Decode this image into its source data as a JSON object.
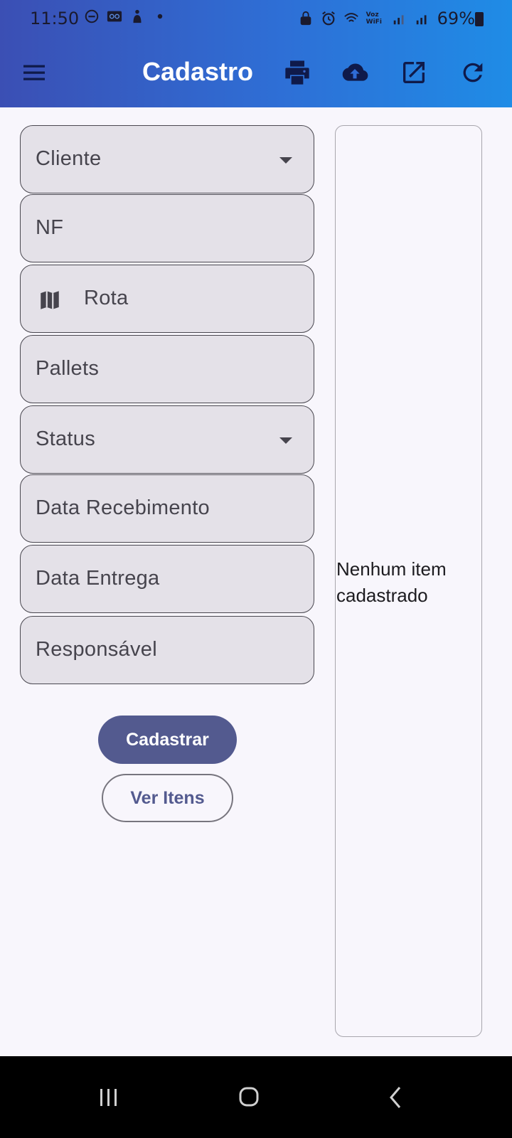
{
  "status_bar": {
    "time": "11:50",
    "network_label": "Voz WiFi",
    "battery": "69%"
  },
  "app_bar": {
    "title": "Cadastro",
    "actions": [
      "menu-icon",
      "print-icon",
      "cloud-upload-icon",
      "open-in-new-icon",
      "refresh-icon"
    ]
  },
  "form": {
    "fields": [
      {
        "label": "Cliente",
        "type": "dropdown"
      },
      {
        "label": "NF",
        "type": "text"
      },
      {
        "label": "Rota",
        "type": "text",
        "icon": "map-icon"
      },
      {
        "label": "Pallets",
        "type": "text"
      },
      {
        "label": "Status",
        "type": "dropdown"
      },
      {
        "label": "Data Recebimento",
        "type": "text"
      },
      {
        "label": "Data Entrega",
        "type": "text"
      },
      {
        "label": "Responsável",
        "type": "text"
      }
    ],
    "submit_label": "Cadastrar",
    "view_label": "Ver Itens"
  },
  "side_panel": {
    "empty_text": "Nenhum item cadastrado"
  },
  "colors": {
    "appbar_start": "#3b4fb4",
    "appbar_end": "#1f8ce6",
    "primary_button": "#535a8f",
    "field_fill": "#e4e1e8",
    "background": "#f8f6fc"
  }
}
